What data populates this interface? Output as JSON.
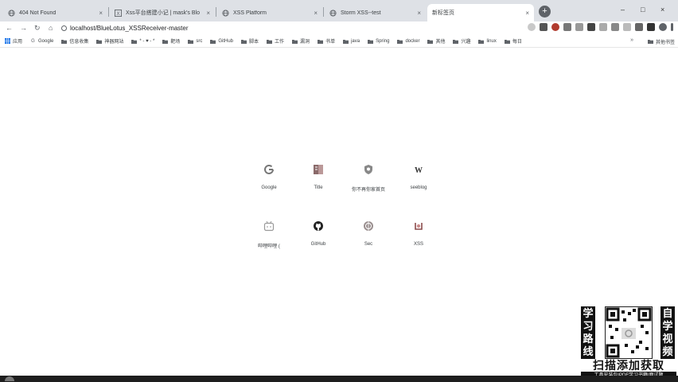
{
  "tabs": [
    {
      "title": "404 Not Found",
      "favicon": "globe-icon",
      "close": "×"
    },
    {
      "title": "Xss平台搭建小记 | mask's Blo",
      "favicon": "x-icon",
      "close": "×"
    },
    {
      "title": "XSS Platform",
      "favicon": "globe-icon",
      "close": "×"
    },
    {
      "title": "Storm XSS--test",
      "favicon": "globe-icon",
      "close": "×"
    },
    {
      "title": "新标签页",
      "favicon": "",
      "close": "×"
    }
  ],
  "new_tab_label": "+",
  "window_controls": {
    "minimize": "–",
    "maximize": "□",
    "close": "×"
  },
  "nav": {
    "back": "←",
    "forward": "→",
    "reload": "↻",
    "home": "⌂"
  },
  "address": "localhost/BlueLotus_XSSReceiver-master",
  "bookmarks": [
    {
      "label": "应用",
      "icon": "apps-icon"
    },
    {
      "label": "Google",
      "icon": "google-icon"
    },
    {
      "label": "信息收集",
      "icon": "folder-icon"
    },
    {
      "label": "神器网站",
      "icon": "folder-icon"
    },
    {
      "label": "* - ♥ - *",
      "icon": "folder-icon"
    },
    {
      "label": "靶场",
      "icon": "folder-icon"
    },
    {
      "label": "src",
      "icon": "folder-icon"
    },
    {
      "label": "GitHub",
      "icon": "folder-icon"
    },
    {
      "label": "脚本",
      "icon": "folder-icon"
    },
    {
      "label": "工作",
      "icon": "folder-icon"
    },
    {
      "label": "漏洞",
      "icon": "folder-icon"
    },
    {
      "label": "书单",
      "icon": "folder-icon"
    },
    {
      "label": "java",
      "icon": "folder-icon"
    },
    {
      "label": "Spring",
      "icon": "folder-icon"
    },
    {
      "label": "docker",
      "icon": "folder-icon"
    },
    {
      "label": "其他",
      "icon": "folder-icon"
    },
    {
      "label": "兴趣",
      "icon": "folder-icon"
    },
    {
      "label": "linux",
      "icon": "folder-icon"
    },
    {
      "label": "每日",
      "icon": "folder-icon"
    }
  ],
  "bookmarks_more": {
    "label": "其他书签",
    "overflow": "»"
  },
  "shortcuts": [
    {
      "label": "Google",
      "icon": "google-icon"
    },
    {
      "label": "Title",
      "icon": "book-icon"
    },
    {
      "label": "你不再你家首页",
      "icon": "shield-icon"
    },
    {
      "label": "seeblog",
      "icon": "w-icon"
    },
    {
      "label": "哔哩哔哩 (",
      "icon": "bilibili-icon"
    },
    {
      "label": "GitHub",
      "icon": "github-icon"
    },
    {
      "label": "Sec",
      "icon": "sec-icon"
    },
    {
      "label": "XSS",
      "icon": "xss-icon"
    }
  ],
  "ad": {
    "left_text": "学习路线",
    "right_text": "自学视频",
    "bottom_text": "扫描添加获取",
    "small_text": "工具安装包|PDF学习书籍|面试题"
  },
  "colors": {
    "tabstrip": "#dee1e6",
    "active_tab": "#ffffff",
    "text": "#3c4043"
  }
}
